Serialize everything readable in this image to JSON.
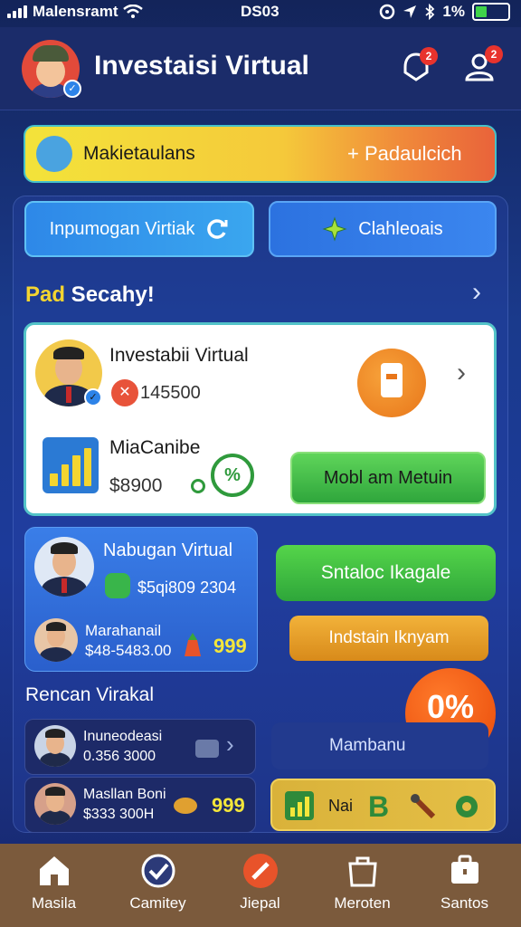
{
  "status_bar": {
    "carrier": "Malensramt",
    "time": "DS03",
    "battery": "1%"
  },
  "header": {
    "title": "Investaisi Virtual",
    "notification_badge": "2",
    "inbox_badge": "2"
  },
  "promo": {
    "label": "Makietaulans",
    "action": "+ Padaulcich"
  },
  "actions": {
    "primary": "Inpumogan Virtiak",
    "secondary": "Clahleoais"
  },
  "section1": {
    "title_highlight": "Pad",
    "title_rest": " Secahy!"
  },
  "featured": {
    "investor_name": "Investabii Virtual",
    "investor_value": "145500",
    "market_name": "MiaCanibe",
    "market_value": "$8900",
    "button": "Mobl am Metuin"
  },
  "nabugan": {
    "name": "Nabugan Virtual",
    "value": "$5qi809 2304",
    "sub_name": "Marahanail",
    "sub_value": "$48-5483.00",
    "score": "999"
  },
  "buttons": {
    "start": "Sntaloc Ikagale",
    "indstain": "Indstain Iknyam"
  },
  "section2": {
    "title": "Rencan Virakal"
  },
  "discount": {
    "value": "0%",
    "sub": "%"
  },
  "list": [
    {
      "name": "Inuneodeasi",
      "value": "0.356 3000"
    },
    {
      "name": "Masllan Boni",
      "value": "$333 300H",
      "score": "999"
    }
  ],
  "mambanu": "Mambanu",
  "gold_bar": {
    "label": "Nai"
  },
  "tabs": [
    {
      "label": "Masila",
      "icon": "home-icon"
    },
    {
      "label": "Camitey",
      "icon": "check-circle-icon"
    },
    {
      "label": "Jiepal",
      "icon": "pencil-icon"
    },
    {
      "label": "Meroten",
      "icon": "bag-icon"
    },
    {
      "label": "Santos",
      "icon": "briefcase-icon"
    }
  ],
  "colors": {
    "accent_green": "#39b54a",
    "accent_orange": "#e8761a",
    "accent_yellow": "#f4d530",
    "tabbar": "#7b5a3c"
  }
}
